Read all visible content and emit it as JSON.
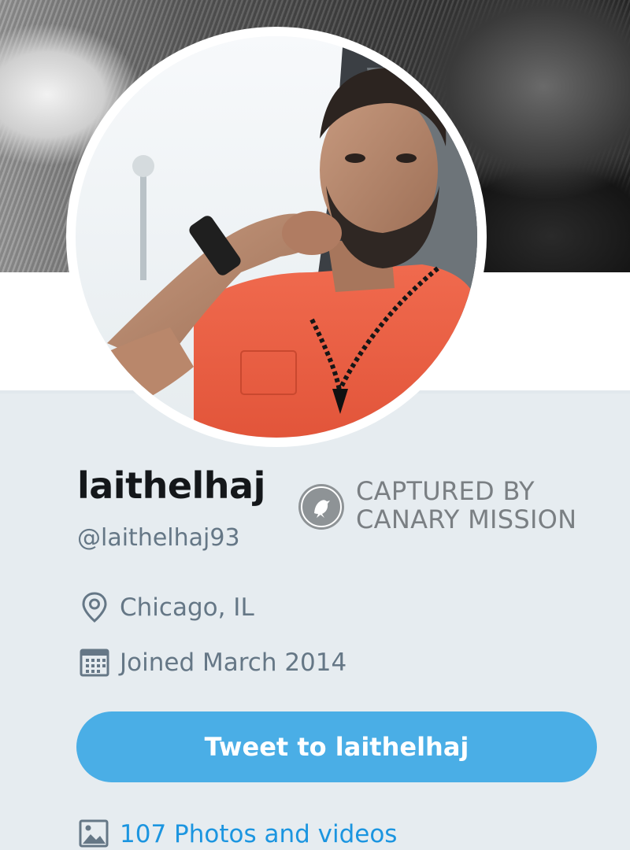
{
  "profile": {
    "display_name": "laithelhaj",
    "handle": "@laithelhaj93",
    "location": "Chicago, IL",
    "joined": "Joined March 2014"
  },
  "watermark": {
    "line1": "CAPTURED BY",
    "line2": "CANARY MISSION",
    "icon": "canary-bird-icon"
  },
  "actions": {
    "tweet_to_label": "Tweet to laithelhaj"
  },
  "media": {
    "photos_label": "107 Photos and videos"
  },
  "icons": {
    "location": "location-pin-icon",
    "joined": "calendar-icon",
    "photos": "image-icon"
  },
  "colors": {
    "accent": "#4aaee6",
    "link": "#1b95e0",
    "background": "#e6ecf0",
    "secondary_text": "#657786"
  }
}
